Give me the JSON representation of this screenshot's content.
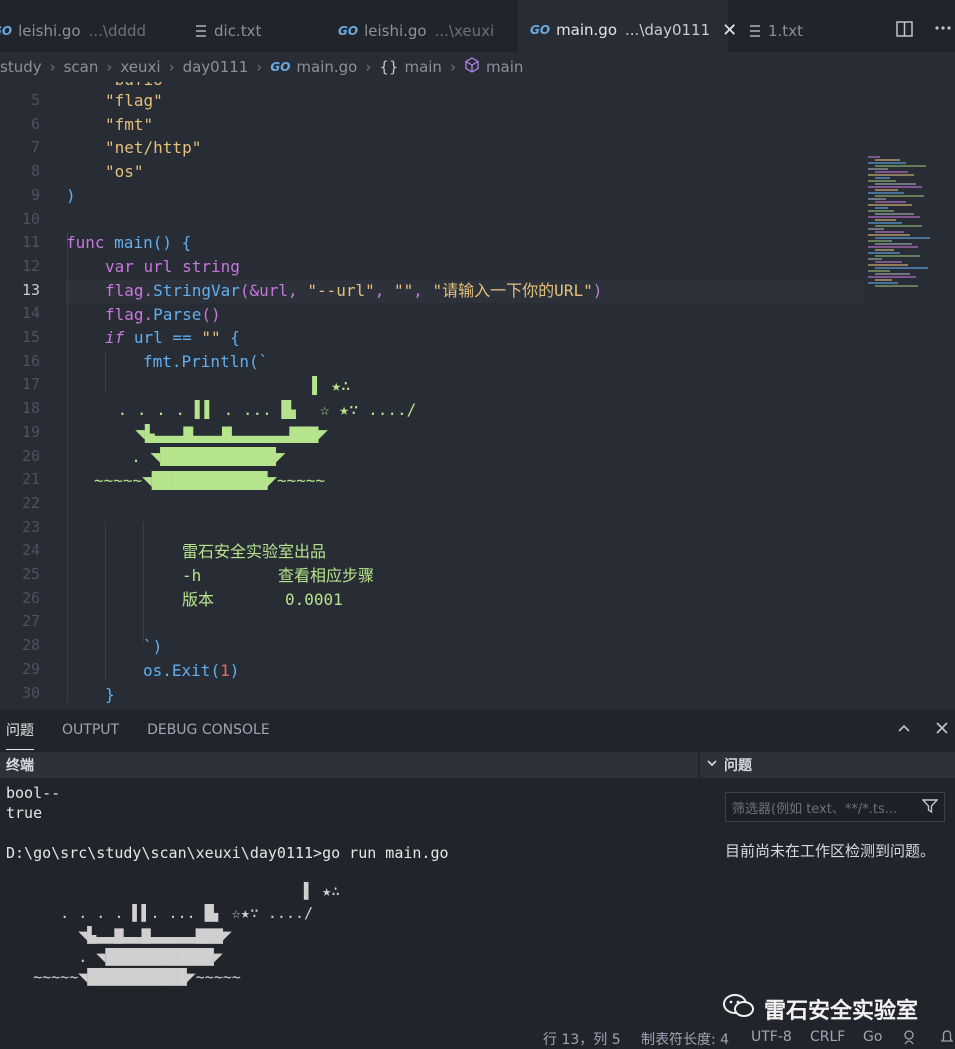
{
  "tabs": [
    {
      "label": "leishi.go",
      "hint": "...\\dddd",
      "icon": "go-icon"
    },
    {
      "label": "dic.txt",
      "hint": "",
      "icon": "text-file-icon"
    },
    {
      "label": "leishi.go",
      "hint": "...\\xeuxi",
      "icon": "go-icon"
    },
    {
      "label": "main.go",
      "hint": "...\\day0111",
      "icon": "go-icon",
      "active": true
    },
    {
      "label": "1.txt",
      "hint": "",
      "icon": "text-file-icon"
    }
  ],
  "tab_close_glyph": "✕",
  "go_badge": "GO",
  "breadcrumbs": {
    "items": [
      "study",
      "scan",
      "xeuxi",
      "day0111",
      "main.go",
      "main",
      "main"
    ],
    "sep": "›",
    "braces": "{}"
  },
  "editor": {
    "line_numbers": [
      "5",
      "6",
      "7",
      "8",
      "9",
      "10",
      "11",
      "12",
      "13",
      "14",
      "15",
      "16",
      "17",
      "18",
      "19",
      "20",
      "21",
      "22",
      "23",
      "24",
      "25",
      "26",
      "27",
      "28",
      "29",
      "30"
    ],
    "current_line": "13",
    "partial_top": "\"bufio\"",
    "imports": [
      "\"flag\"",
      "\"fmt\"",
      "\"net/http\"",
      "\"os\""
    ],
    "close_paren": ")",
    "func_kw": "func",
    "func_name": "main",
    "func_sig": "() {",
    "var_kw": "var",
    "var_rest": " url ",
    "var_type": "string",
    "l13_a": "flag.",
    "l13_fn": "StringVar",
    "l13_b": "(&url, ",
    "l13_s1": "\"--url\"",
    "l13_c": ", ",
    "l13_s2": "\"\"",
    "l13_d": ", ",
    "l13_s3": "\"请输入一下你的URL\"",
    "l13_e": ")",
    "l14_a": "flag.",
    "l14_fn": "Parse",
    "l14_b": "()",
    "if_kw": "if",
    "if_rest": " url == ",
    "if_str": "\"\"",
    "if_brace": " {",
    "println_a": "fmt.",
    "println_fn": "Println",
    "println_b": "(`",
    "art": [
      "                ▌ ★∴",
      " . . . . ▌▌ . ... █▖  ☆ ★∵ ..../",
      "  ◥▙▃▃▃▇▃▃▃▇▃▃▃▃▃▃▇▇▇◤",
      "  . ◥████████████◤",
      "~~~~~◥████████████◤~~~~~"
    ],
    "info": [
      {
        "k": "雷石安全实验室出品",
        "v": ""
      },
      {
        "k": "-h",
        "v": "查看相应步骤"
      },
      {
        "k": "版本",
        "v": "0.0001"
      }
    ],
    "backtick_close": "`)",
    "exit_a": "os.",
    "exit_fn": "Exit",
    "exit_b": "(",
    "exit_num": "1",
    "exit_c": ")",
    "close_brace": "}"
  },
  "panel": {
    "tabs": [
      "问题",
      "OUTPUT",
      "DEBUG CONSOLE"
    ],
    "terminal_title": "终端",
    "problems_title": "问题",
    "filter_placeholder": "筛选器(例如 text、**/*.ts...",
    "no_problems": "目前尚未在工作区检测到问题。",
    "terminal_lines": [
      "bool--",
      "true",
      "",
      "D:\\go\\src\\study\\scan\\xeuxi\\day0111>go run main.go"
    ],
    "terminal_art": [
      "                                 ▌ ★∴",
      "      . . . . ▌▌. ... █▖ ☆★∵ ..../",
      "        ◥▙▃▃▇▃▃▇▃▃▃▃▃▇▇▇◤",
      "        . ◥████████████◤",
      "   ~~~~~◥███████████◤~~~~~"
    ]
  },
  "watermark": "雷石安全实验室",
  "statusbar": {
    "position": "行 13，列 5",
    "tab_size": "制表符长度: 4",
    "encoding": "UTF-8",
    "eol": "CRLF",
    "language": "Go"
  },
  "colors": {
    "accent": "#2f7de1",
    "string": "#e5c07b",
    "keyword": "#c678dd",
    "function": "#61afef",
    "art": "#b5e48c"
  }
}
